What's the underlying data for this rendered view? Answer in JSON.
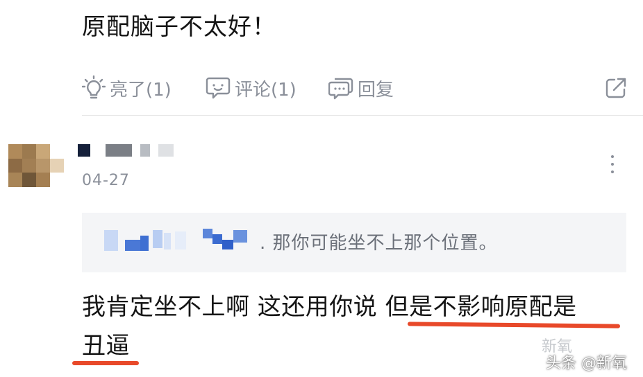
{
  "top_comment": {
    "text": "原配脑子不太好！"
  },
  "actions": {
    "like_label": "亮了(1)",
    "comment_label": "评论(1)",
    "reply_label": "回复"
  },
  "icons": {
    "like": "lightbulb-icon",
    "comment": "comment-bubble-icon",
    "reply": "reply-bubble-icon",
    "share": "share-icon",
    "more": "more-vertical-icon"
  },
  "second_comment": {
    "date": "04-27",
    "quote_text": ". 那你可能坐不上那个位置。",
    "line1": "我肯定坐不上啊 这还用你说 但是不影响原配是",
    "line2": "丑逼"
  },
  "watermark": {
    "logo_text": "新氧",
    "text": "头条 @新氧"
  },
  "colors": {
    "underline": "#e8492a",
    "muted": "#8a8f99",
    "quote_bg": "#f4f5f7"
  }
}
